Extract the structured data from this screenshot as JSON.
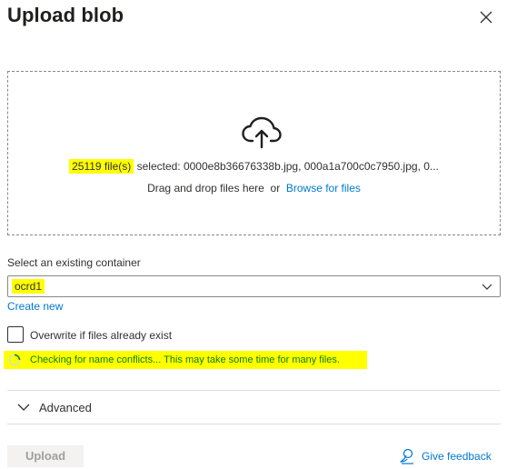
{
  "header": {
    "title": "Upload blob",
    "close_icon": "close-icon"
  },
  "dropzone": {
    "icon": "cloud-upload-icon",
    "file_count": "25119 file(s)",
    "selected_text": " selected: 0000e8b36676338b.jpg, 000a1a700c0c7950.jpg, 0...",
    "drag_text": "Drag and drop files here",
    "or_text": "or",
    "browse_link": "Browse for files"
  },
  "container": {
    "label": "Select an existing container",
    "selected_value": "ocrd1",
    "create_new": "Create new"
  },
  "overwrite": {
    "label": "Overwrite if files already exist",
    "checked": false
  },
  "status": {
    "text": "Checking for name conflicts... This may take some time for many files.",
    "color": "#107c10"
  },
  "advanced": {
    "label": "Advanced",
    "expanded": false
  },
  "footer": {
    "upload_label": "Upload",
    "upload_enabled": false,
    "feedback_label": "Give feedback"
  },
  "colors": {
    "accent": "#0078d4",
    "highlight": "#ffff00"
  }
}
